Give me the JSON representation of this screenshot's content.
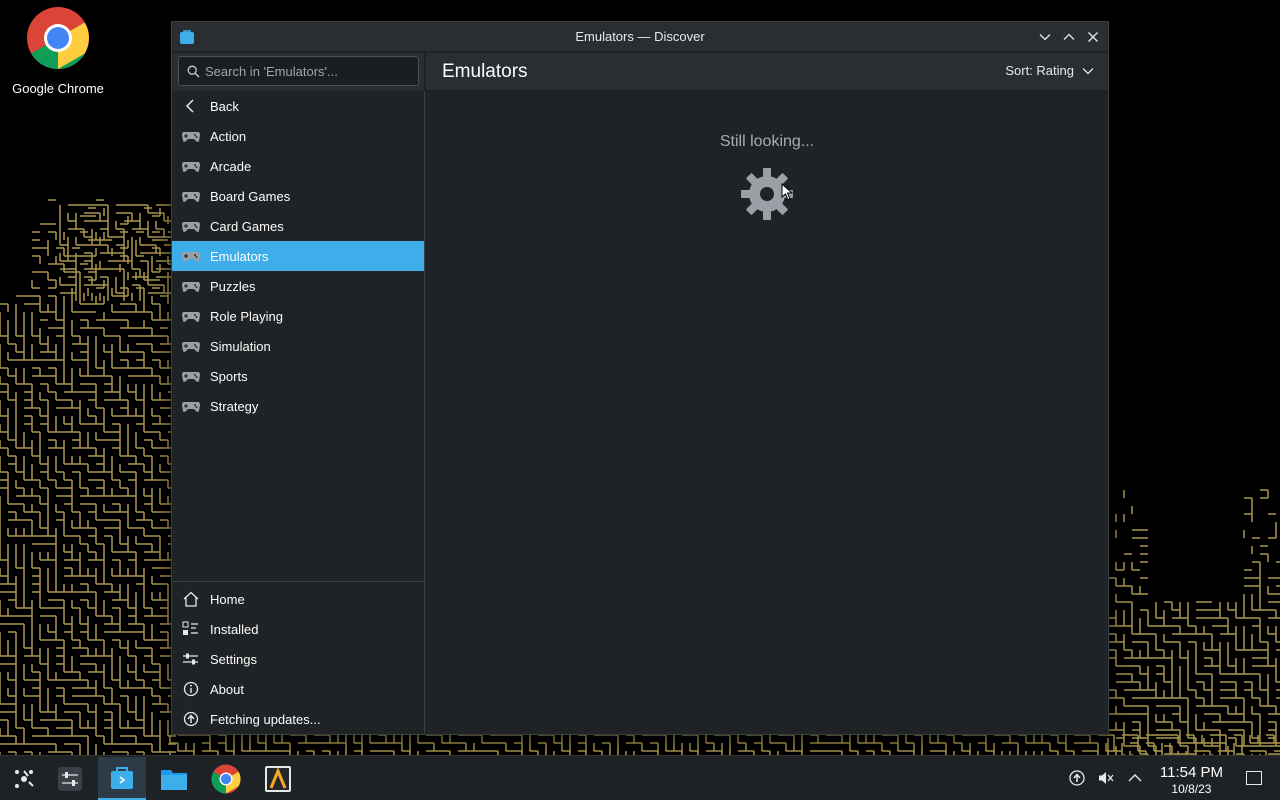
{
  "desktop": {
    "icons": [
      {
        "label": "Google Chrome",
        "icon": "chrome-icon"
      }
    ]
  },
  "window": {
    "title": "Emulators — Discover",
    "search_placeholder": "Search in 'Emulators'...",
    "page_title": "Emulators",
    "sort_label": "Sort: Rating",
    "status_text": "Still looking...",
    "sidebar": {
      "back_label": "Back",
      "categories": [
        {
          "label": "Action",
          "selected": false
        },
        {
          "label": "Arcade",
          "selected": false
        },
        {
          "label": "Board Games",
          "selected": false
        },
        {
          "label": "Card Games",
          "selected": false
        },
        {
          "label": "Emulators",
          "selected": true
        },
        {
          "label": "Puzzles",
          "selected": false
        },
        {
          "label": "Role Playing",
          "selected": false
        },
        {
          "label": "Simulation",
          "selected": false
        },
        {
          "label": "Sports",
          "selected": false
        },
        {
          "label": "Strategy",
          "selected": false
        }
      ],
      "bottom": [
        {
          "label": "Home",
          "icon": "home-icon"
        },
        {
          "label": "Installed",
          "icon": "installed-icon"
        },
        {
          "label": "Settings",
          "icon": "settings-sliders-icon"
        },
        {
          "label": "About",
          "icon": "info-icon"
        },
        {
          "label": "Fetching updates...",
          "icon": "update-arrow-icon"
        }
      ]
    }
  },
  "taskbar": {
    "time": "11:54 PM",
    "date": "10/8/23",
    "apps": [
      "app-launcher-icon",
      "system-settings-icon",
      "discover-icon",
      "file-manager-icon",
      "chrome-icon",
      "steam-deck-icon"
    ]
  },
  "colors": {
    "accent": "#3daee9",
    "window_bg": "#202326",
    "header_bg": "#2a2e32",
    "maze": "#c9b25a"
  }
}
